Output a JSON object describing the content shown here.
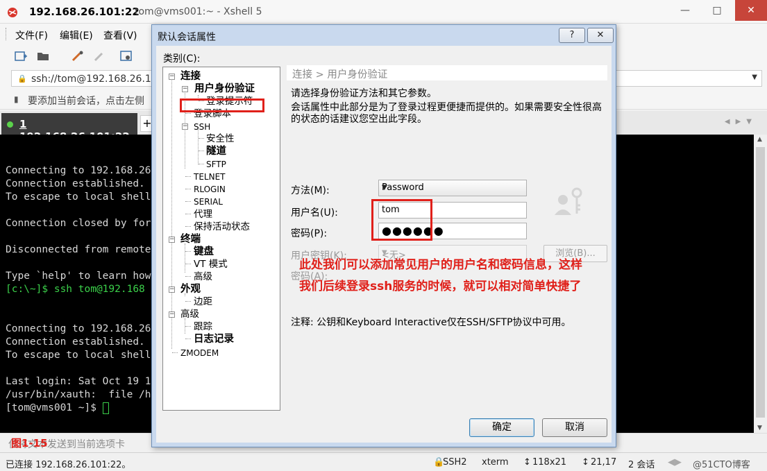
{
  "window": {
    "title_host": "192.168.26.101:22",
    "title_rest": "tom@vms001:~ - Xshell 5",
    "controls": [
      "—",
      "□",
      "✕"
    ]
  },
  "menu": [
    "文件(F)",
    "编辑(E)",
    "查看(V)"
  ],
  "address": {
    "text": "ssh://tom@192.168.26.1"
  },
  "hint": {
    "text": "要添加当前会话，点击左侧"
  },
  "tab": {
    "index": "1",
    "label": " 192.168.26.101:22",
    "add": "+"
  },
  "terminal": {
    "lines": [
      "",
      "Connecting to 192.168.26",
      "Connection established.",
      "To escape to local shell",
      "",
      "Connection closed by for",
      "",
      "Disconnected from remote",
      "",
      "Type `help' to learn how",
      "[c:\\~]$ ssh tom@192.168",
      "",
      "",
      "Connecting to 192.168.26",
      "Connection established.",
      "To escape to local shell",
      "",
      "Last login: Sat Oct 19 1",
      "/usr/bin/xauth:  file /h",
      "[tom@vms001 ~]$ "
    ]
  },
  "sendbar": {
    "text": "仅将文本发送到当前选项卡"
  },
  "figure_label": "图1-15",
  "status": {
    "connected": "已连接 192.168.26.101:22。",
    "protocol": "SSH2",
    "term": "xterm",
    "size": "118x21",
    "pos": "21,17",
    "sessions": "2 会话",
    "watermark": "@51CTO博客"
  },
  "dialog": {
    "title": "默认会话属性",
    "help_btn": "?",
    "close_btn": "✕",
    "category_label": "类别(C):",
    "tree": {
      "connection": "连接",
      "auth": "用户身份验证",
      "login_prompt": "登录提示符",
      "login_script": "登录脚本",
      "ssh": "SSH",
      "security": "安全性",
      "tunnel": "隧道",
      "sftp": "SFTP",
      "telnet": "TELNET",
      "rlogin": "RLOGIN",
      "serial": "SERIAL",
      "proxy": "代理",
      "keepalive": "保持活动状态",
      "terminal": "终端",
      "keyboard": "键盘",
      "vt_mode": "VT 模式",
      "advanced1": "高级",
      "appearance": "外观",
      "margin": "边距",
      "advanced2": "高级",
      "trace": "跟踪",
      "log": "日志记录",
      "zmodem": "ZMODEM"
    },
    "breadcrumb": "连接 > 用户身份验证",
    "desc1": "请选择身份验证方法和其它参数。",
    "desc2": "会话属性中此部分是为了登录过程更便捷而提供的。如果需要安全性很高的状态的话建议您空出此字段。",
    "method_label": "方法(M):",
    "method_value": "Password",
    "user_label": "用户名(U):",
    "user_value": "tom",
    "pass_label": "密码(P):",
    "pass_value": "●●●●●●",
    "key_label": "用户密钥(K):",
    "key_value": "<无>",
    "browse": "浏览(B)...",
    "passphrase_label": "密码(A):",
    "annotation_line1": "此处我们可以添加常见用户的用户名和密码信息，这样",
    "annotation_line2": "我们后续登录ssh服务的时候，就可以相对简单快捷了",
    "note": "注释: 公钥和Keyboard Interactive仅在SSH/SFTP协议中可用。",
    "ok": "确定",
    "cancel": "取消"
  }
}
